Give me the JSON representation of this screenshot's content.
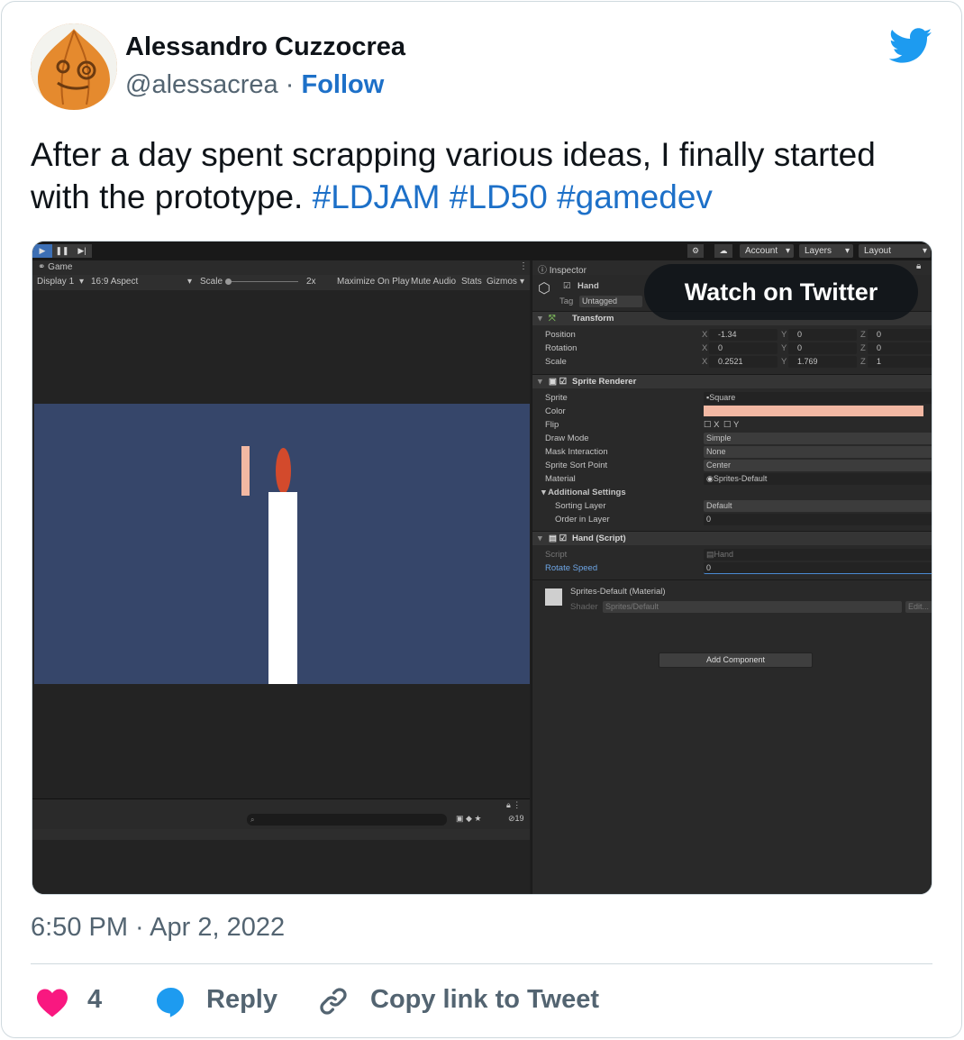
{
  "author": {
    "name": "Alessandro Cuzzocrea",
    "handle": "@alessacrea",
    "separator": "·",
    "follow_label": "Follow"
  },
  "tweet": {
    "text_plain": "After a day spent scrapping various ideas, I finally started with the prototype.",
    "hashtags": [
      "#LDJAM",
      "#LD50",
      "#gamedev"
    ],
    "timestamp": "6:50 PM · Apr 2, 2022"
  },
  "media": {
    "watch_label": "Watch on Twitter",
    "toolbar": {
      "account": "Account",
      "layers": "Layers",
      "layout": "Layout"
    },
    "game": {
      "tab_label": "Game",
      "display": "Display 1",
      "aspect": "16:9 Aspect",
      "scale_label": "Scale",
      "scale_value": "2x",
      "maximize": "Maximize On Play",
      "mute": "Mute Audio",
      "stats": "Stats",
      "gizmos": "Gizmos",
      "console_count": "19"
    },
    "inspector": {
      "tab_label": "Inspector",
      "object_name": "Hand",
      "tag_label": "Tag",
      "tag_value": "Untagged",
      "transform": {
        "title": "Transform",
        "position_label": "Position",
        "position": [
          "-1.34",
          "0",
          "0"
        ],
        "rotation_label": "Rotation",
        "rotation": [
          "0",
          "0",
          "0"
        ],
        "scale_label": "Scale",
        "scale": [
          "0.2521",
          "1.769",
          "1"
        ]
      },
      "sprite_renderer": {
        "title": "Sprite Renderer",
        "sprite_label": "Sprite",
        "sprite_value": "Square",
        "color_label": "Color",
        "color_value": "#f2b8a3",
        "flip_label": "Flip",
        "flip_x": "X",
        "flip_y": "Y",
        "draw_mode_label": "Draw Mode",
        "draw_mode_value": "Simple",
        "mask_label": "Mask Interaction",
        "mask_value": "None",
        "sort_point_label": "Sprite Sort Point",
        "sort_point_value": "Center",
        "material_label": "Material",
        "material_value": "Sprites-Default",
        "additional_label": "Additional Settings",
        "sorting_layer_label": "Sorting Layer",
        "sorting_layer_value": "Default",
        "order_label": "Order in Layer",
        "order_value": "0"
      },
      "hand_script": {
        "title": "Hand (Script)",
        "script_label": "Script",
        "script_value": "Hand",
        "rotate_label": "Rotate Speed",
        "rotate_value": "0"
      },
      "material": {
        "title": "Sprites-Default (Material)",
        "shader_label": "Shader",
        "shader_value": "Sprites/Default",
        "edit_label": "Edit..."
      },
      "add_component": "Add Component"
    }
  },
  "actions": {
    "like_count": "4",
    "reply_label": "Reply",
    "copy_label": "Copy link to Tweet"
  },
  "colors": {
    "link_blue": "#1d70c8",
    "twitter_blue": "#1d9bf0",
    "heart_pink": "#f91880",
    "viewport_bg": "#36466a",
    "flame": "#d34a2c"
  }
}
